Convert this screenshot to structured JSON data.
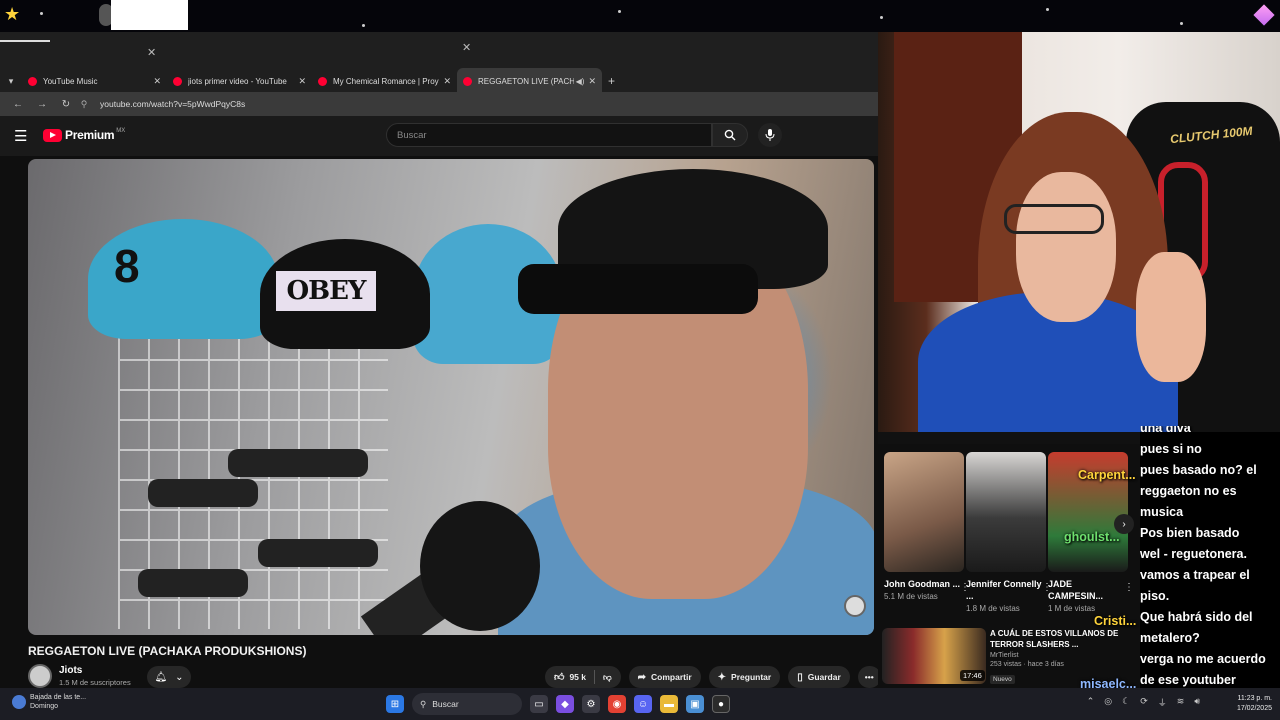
{
  "browser": {
    "tabs": [
      {
        "label": "YouTube Music"
      },
      {
        "label": "jiots primer video - YouTube"
      },
      {
        "label": "My Chemical Romance | Proyect"
      },
      {
        "label": "REGGAETON LIVE (PACHAKA"
      }
    ],
    "url": "youtube.com/watch?v=5pWwdPqyC8s"
  },
  "youtube": {
    "logo_text": "Premium",
    "region": "MX",
    "search_placeholder": "Buscar",
    "video_overlay_text": "OBEY",
    "video_cap_number": "8",
    "video_title": "REGGAETON LIVE (PACHAKA PRODUKSHIONS)",
    "channel_name": "Jiots",
    "channel_subs": "1.5 M de suscriptores",
    "likes": "95 k",
    "share_label": "Compartir",
    "ask_label": "Preguntar",
    "save_label": "Guardar"
  },
  "stream": {
    "chair_brand": "CLUTCH 100M",
    "recommended": [
      {
        "title": "John Goodman ...",
        "views": "5.1 M de vistas"
      },
      {
        "title": "Jennifer Connelly ...",
        "views": "1.8 M de vistas"
      },
      {
        "title": "JADE CAMPESIN...",
        "views": "1 M de vistas"
      }
    ],
    "wide_rec": {
      "title": "A CUÁL DE ESTOS VILLANOS DE TERROR SLASHERS ...",
      "channel": "MrTierlist",
      "meta": "253 vistas · hace 3 días",
      "badge": "Nuevo",
      "duration": "17:46"
    },
    "overlay_names": [
      "Carpent...",
      "ghoulst...",
      "Cristi...",
      "misaelc..."
    ],
    "chat": [
      "una diva",
      "pues si no",
      "pues basado no? el reggaeton no es musica",
      "Pos bien basado",
      "wel - reguetonera. vamos a trapear el piso.",
      "Que habrá sido del metalero?",
      "verga no me acuerdo de ese youtuber"
    ]
  },
  "taskbar": {
    "weather_line1": "Bajada de las te...",
    "weather_line2": "Domingo",
    "search_label": "Buscar",
    "time": "11:23 p. m.",
    "date": "17/02/2025"
  },
  "colors": {
    "yt_red": "#ff0033",
    "bg_dark": "#0f0f0f",
    "taskbar": "#1c1d24"
  }
}
